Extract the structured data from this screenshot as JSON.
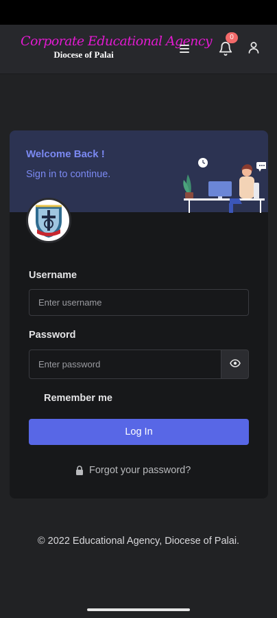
{
  "header": {
    "brand_title": "Corporate Educational Agency",
    "brand_subtitle": "Diocese of Palai",
    "notification_count": "0",
    "icons": [
      "menu-icon",
      "bell-icon",
      "user-icon"
    ]
  },
  "login_card": {
    "welcome": "Welcome Back !",
    "subtitle": "Sign in to continue.",
    "username_label": "Username",
    "username_placeholder": "Enter username",
    "username_value": "",
    "password_label": "Password",
    "password_placeholder": "Enter password",
    "password_value": "",
    "remember_label": "Remember me",
    "login_button": "Log In",
    "forgot_link": "Forgot your password?"
  },
  "footer": {
    "copyright": "© 2022 Educational Agency, Diocese of Palai."
  },
  "colors": {
    "background": "#212224",
    "card": "#17181a",
    "card_header": "#2c3352",
    "accent": "#5867e6",
    "brand": "#e21ad0",
    "badge": "#f26a6a"
  }
}
